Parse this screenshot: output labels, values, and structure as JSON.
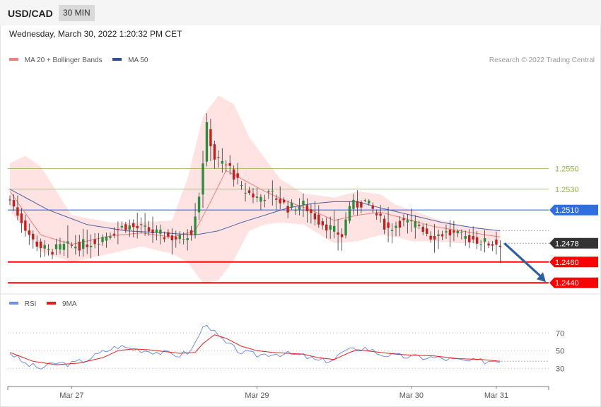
{
  "header": {
    "symbol": "USD/CAD",
    "timeframe": "30 MIN",
    "datetime": "Wednesday, March 30, 2022 1:20:32 PM CET"
  },
  "legend": {
    "bb_label": "MA 20 + Bollinger Bands",
    "ma50_label": "MA 50",
    "credit": "Research © 2022 Trading Central"
  },
  "rsi_legend": {
    "rsi_label": "RSI",
    "ma_label": "9MA"
  },
  "colors": {
    "bull": "#2e8b3d",
    "bear": "#c0221f",
    "band_fill": "#ffe3e3",
    "ma20": "#f08080",
    "ma50": "#4a5fa8",
    "resistance": "#8fb53a",
    "pivot": "#2f6ee0",
    "support": "#ff0000",
    "current": "#333333",
    "rsi": "#6f8fe0",
    "rsi_ma": "#e02020",
    "arrow": "#2f5f9f"
  },
  "chart_data": [
    {
      "type": "candlestick",
      "title": "USD/CAD",
      "timeframe": "30 MIN",
      "ylim": [
        1.2432,
        1.2644
      ],
      "x_count": 140,
      "x_ticks": [
        {
          "label": "Mar 27",
          "index": 16
        },
        {
          "label": "Mar 29",
          "index": 64
        },
        {
          "label": "Mar 30",
          "index": 104
        },
        {
          "label": "Mar 31",
          "index": 126
        }
      ],
      "levels": [
        {
          "value": 1.255,
          "label": "1.2550",
          "kind": "resistance"
        },
        {
          "value": 1.253,
          "label": "1.2530",
          "kind": "resistance"
        },
        {
          "value": 1.251,
          "label": "1.2510",
          "kind": "pivot"
        },
        {
          "value": 1.2478,
          "label": "1.2478",
          "kind": "current"
        },
        {
          "value": 1.246,
          "label": "1.2460",
          "kind": "support"
        },
        {
          "value": 1.244,
          "label": "1.2440",
          "kind": "support"
        }
      ],
      "anchors": [
        [
          0,
          1.252
        ],
        [
          6,
          1.248
        ],
        [
          10,
          1.247
        ],
        [
          14,
          1.2475
        ],
        [
          18,
          1.2476
        ],
        [
          22,
          1.248
        ],
        [
          26,
          1.2488
        ],
        [
          30,
          1.2495
        ],
        [
          36,
          1.249
        ],
        [
          40,
          1.2485
        ],
        [
          44,
          1.2482
        ],
        [
          47,
          1.249
        ],
        [
          49,
          1.2525
        ],
        [
          51,
          1.259
        ],
        [
          53,
          1.256
        ],
        [
          57,
          1.255
        ],
        [
          60,
          1.253
        ],
        [
          64,
          1.2522
        ],
        [
          68,
          1.2525
        ],
        [
          72,
          1.2512
        ],
        [
          76,
          1.2515
        ],
        [
          80,
          1.25
        ],
        [
          84,
          1.249
        ],
        [
          86,
          1.2485
        ],
        [
          88,
          1.2515
        ],
        [
          90,
          1.2515
        ],
        [
          92,
          1.2518
        ],
        [
          94,
          1.251
        ],
        [
          96,
          1.25
        ],
        [
          98,
          1.2492
        ],
        [
          101,
          1.2498
        ],
        [
          106,
          1.2496
        ],
        [
          109,
          1.2485
        ],
        [
          113,
          1.2488
        ],
        [
          117,
          1.2484
        ],
        [
          120,
          1.2482
        ],
        [
          124,
          1.2478
        ],
        [
          127,
          1.2478
        ]
      ],
      "bands": {
        "ma20": [
          [
            0,
            1.2528
          ],
          [
            8,
            1.2486
          ],
          [
            16,
            1.2477
          ],
          [
            26,
            1.2485
          ],
          [
            34,
            1.2488
          ],
          [
            42,
            1.2484
          ],
          [
            48,
            1.249
          ],
          [
            52,
            1.2518
          ],
          [
            56,
            1.2548
          ],
          [
            60,
            1.254
          ],
          [
            66,
            1.2528
          ],
          [
            72,
            1.2518
          ],
          [
            78,
            1.251
          ],
          [
            84,
            1.25
          ],
          [
            90,
            1.2505
          ],
          [
            96,
            1.2508
          ],
          [
            102,
            1.2502
          ],
          [
            110,
            1.2494
          ],
          [
            120,
            1.2488
          ],
          [
            127,
            1.2484
          ]
        ],
        "upper": [
          [
            0,
            1.2555
          ],
          [
            4,
            1.2562
          ],
          [
            8,
            1.2552
          ],
          [
            16,
            1.2505
          ],
          [
            26,
            1.2498
          ],
          [
            34,
            1.2498
          ],
          [
            42,
            1.25
          ],
          [
            46,
            1.254
          ],
          [
            50,
            1.26
          ],
          [
            54,
            1.262
          ],
          [
            58,
            1.2612
          ],
          [
            62,
            1.258
          ],
          [
            66,
            1.256
          ],
          [
            70,
            1.254
          ],
          [
            76,
            1.2526
          ],
          [
            84,
            1.2522
          ],
          [
            90,
            1.2528
          ],
          [
            96,
            1.2525
          ],
          [
            100,
            1.2515
          ],
          [
            104,
            1.251
          ],
          [
            110,
            1.2502
          ],
          [
            116,
            1.2496
          ],
          [
            127,
            1.249
          ]
        ],
        "lower": [
          [
            0,
            1.251
          ],
          [
            4,
            1.249
          ],
          [
            8,
            1.247
          ],
          [
            16,
            1.246
          ],
          [
            26,
            1.2468
          ],
          [
            34,
            1.2475
          ],
          [
            42,
            1.2468
          ],
          [
            46,
            1.246
          ],
          [
            50,
            1.244
          ],
          [
            54,
            1.2442
          ],
          [
            58,
            1.2462
          ],
          [
            62,
            1.249
          ],
          [
            66,
            1.2496
          ],
          [
            70,
            1.2498
          ],
          [
            76,
            1.2496
          ],
          [
            84,
            1.2478
          ],
          [
            90,
            1.248
          ],
          [
            96,
            1.2486
          ],
          [
            100,
            1.2484
          ],
          [
            104,
            1.248
          ],
          [
            110,
            1.248
          ],
          [
            116,
            1.2478
          ],
          [
            127,
            1.2478
          ]
        ],
        "ma50": [
          [
            0,
            1.253
          ],
          [
            10,
            1.251
          ],
          [
            20,
            1.2496
          ],
          [
            30,
            1.249
          ],
          [
            40,
            1.2488
          ],
          [
            48,
            1.2486
          ],
          [
            54,
            1.249
          ],
          [
            60,
            1.2498
          ],
          [
            66,
            1.2505
          ],
          [
            72,
            1.2512
          ],
          [
            78,
            1.2516
          ],
          [
            84,
            1.2518
          ],
          [
            90,
            1.2518
          ],
          [
            96,
            1.2512
          ],
          [
            104,
            1.2505
          ],
          [
            112,
            1.2498
          ],
          [
            120,
            1.2493
          ],
          [
            127,
            1.249
          ]
        ]
      }
    },
    {
      "type": "line",
      "title": "RSI",
      "ylim": [
        15,
        95
      ],
      "y_ticks": [
        70,
        50,
        30
      ],
      "series": [
        {
          "name": "RSI",
          "anchors": [
            [
              0,
              48
            ],
            [
              4,
              35
            ],
            [
              8,
              30
            ],
            [
              12,
              36
            ],
            [
              16,
              35
            ],
            [
              20,
              40
            ],
            [
              24,
              48
            ],
            [
              28,
              55
            ],
            [
              32,
              52
            ],
            [
              36,
              50
            ],
            [
              40,
              47
            ],
            [
              44,
              45
            ],
            [
              47,
              50
            ],
            [
              49,
              68
            ],
            [
              51,
              82
            ],
            [
              53,
              70
            ],
            [
              56,
              58
            ],
            [
              60,
              48
            ],
            [
              64,
              45
            ],
            [
              68,
              47
            ],
            [
              72,
              46
            ],
            [
              76,
              44
            ],
            [
              80,
              38
            ],
            [
              84,
              40
            ],
            [
              86,
              48
            ],
            [
              88,
              50
            ],
            [
              90,
              52
            ],
            [
              92,
              53
            ],
            [
              94,
              50
            ],
            [
              96,
              46
            ],
            [
              100,
              44
            ],
            [
              104,
              43
            ],
            [
              110,
              42
            ],
            [
              114,
              40
            ],
            [
              118,
              38
            ],
            [
              122,
              38
            ],
            [
              127,
              39
            ]
          ]
        },
        {
          "name": "9MA",
          "anchors": [
            [
              0,
              48
            ],
            [
              6,
              38
            ],
            [
              12,
              34
            ],
            [
              18,
              36
            ],
            [
              24,
              42
            ],
            [
              28,
              50
            ],
            [
              32,
              52
            ],
            [
              36,
              51
            ],
            [
              40,
              49
            ],
            [
              44,
              47
            ],
            [
              48,
              48
            ],
            [
              50,
              58
            ],
            [
              53,
              68
            ],
            [
              56,
              64
            ],
            [
              60,
              55
            ],
            [
              64,
              50
            ],
            [
              68,
              48
            ],
            [
              72,
              47
            ],
            [
              76,
              46
            ],
            [
              80,
              42
            ],
            [
              84,
              40
            ],
            [
              86,
              44
            ],
            [
              88,
              48
            ],
            [
              90,
              51
            ],
            [
              92,
              50
            ],
            [
              96,
              48
            ],
            [
              100,
              46
            ],
            [
              104,
              45
            ],
            [
              110,
              44
            ],
            [
              116,
              41
            ],
            [
              122,
              40
            ],
            [
              127,
              38
            ]
          ]
        }
      ]
    }
  ]
}
